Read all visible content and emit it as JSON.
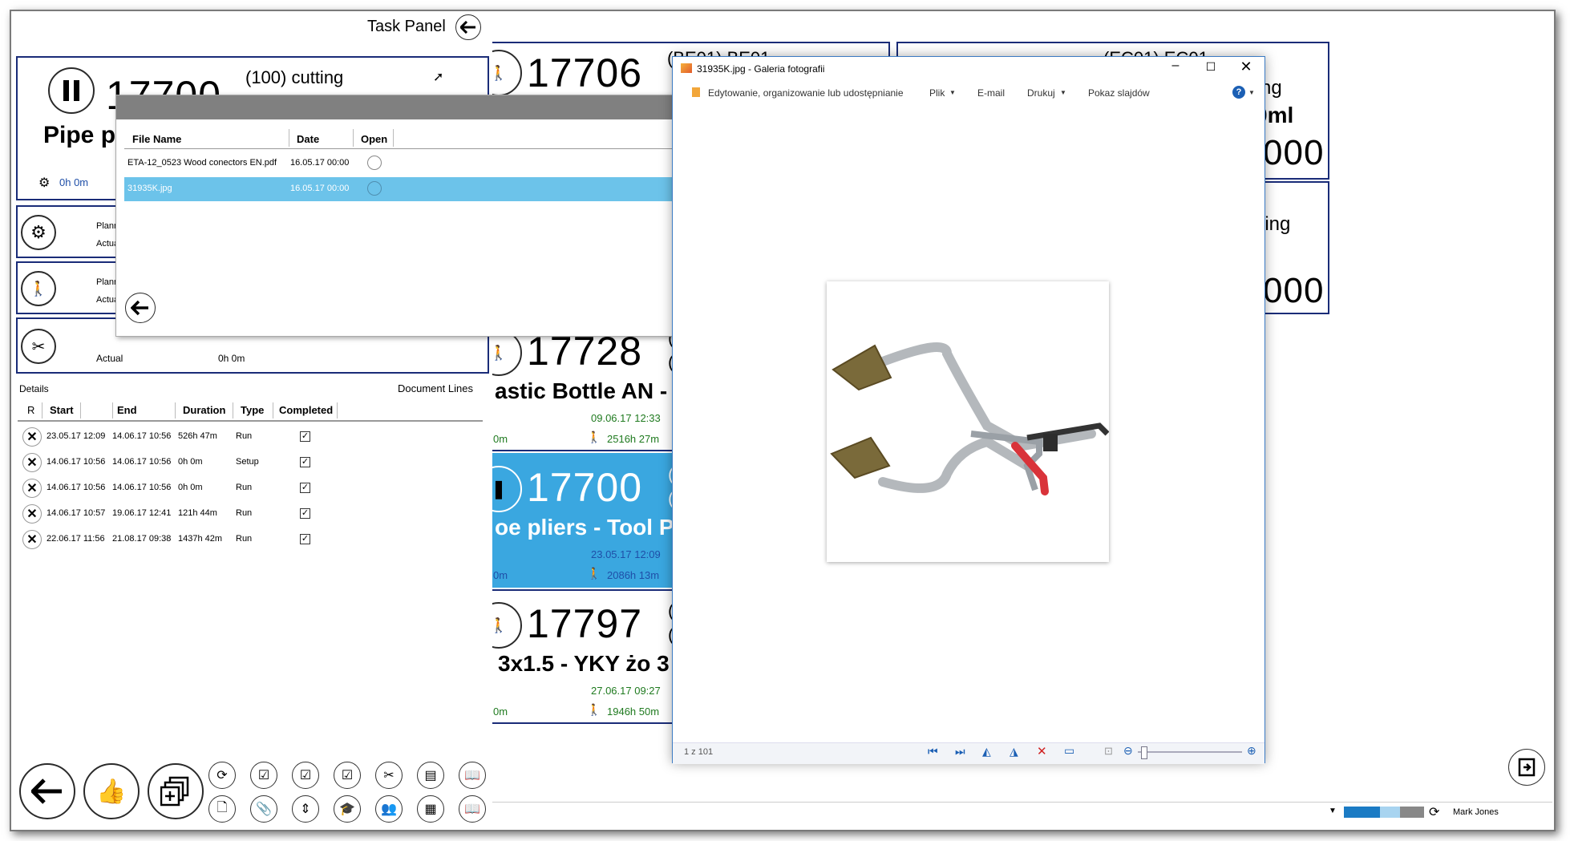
{
  "task_panel": {
    "title": "Task Panel",
    "current": {
      "number": "17700",
      "operation": "(100) cutting",
      "product": "Pipe p",
      "setup_time": "0h 0m"
    },
    "rows": [
      {
        "label1": "Plann",
        "label2": "Actua"
      },
      {
        "label1": "Plann",
        "label2": "Actua"
      },
      {
        "label2": "Actual",
        "value": "0h 0m"
      }
    ],
    "details_label": "Details",
    "document_lines_label": "Document Lines",
    "columns": [
      "R",
      "Start",
      "End",
      "Duration",
      "Type",
      "Completed"
    ],
    "details": [
      {
        "start": "23.05.17 12:09",
        "end": "14.06.17 10:56",
        "duration": "526h 47m",
        "type": "Run",
        "completed": true
      },
      {
        "start": "14.06.17 10:56",
        "end": "14.06.17 10:56",
        "duration": "0h 0m",
        "type": "Setup",
        "completed": true
      },
      {
        "start": "14.06.17 10:56",
        "end": "14.06.17 10:56",
        "duration": "0h 0m",
        "type": "Run",
        "completed": true
      },
      {
        "start": "14.06.17 10:57",
        "end": "19.06.17 12:41",
        "duration": "121h 44m",
        "type": "Run",
        "completed": true
      },
      {
        "start": "22.06.17 11:56",
        "end": "21.08.17 09:38",
        "duration": "1437h 42m",
        "type": "Run",
        "completed": true
      }
    ]
  },
  "files_dialog": {
    "columns": [
      "File Name",
      "Date",
      "Open"
    ],
    "files": [
      {
        "name": "ETA-12_0523 Wood conectors EN.pdf",
        "date": "16.05.17 00:00",
        "selected": false
      },
      {
        "name": "31935K.jpg",
        "date": "16.05.17 00:00",
        "selected": true
      }
    ]
  },
  "job_cards": [
    {
      "number": "17706",
      "code": "(BE01) BE01"
    },
    {
      "number": "17728",
      "paren": "(",
      "paren2": "(",
      "product": "astic Bottle AN -",
      "date": "09.06.17 12:33",
      "time_left": "0m",
      "time_right": "2516h 27m"
    },
    {
      "number": "17700",
      "paren": "(",
      "paren2": "(",
      "product": "oe pliers - Tool P",
      "date": "23.05.17 12:09",
      "time_left": "0m",
      "time_right": "2086h 13m",
      "active": true
    },
    {
      "number": "17797",
      "paren": "(",
      "paren2": "(",
      "product": "3x1.5 - YKY żo 3",
      "date": "27.06.17 09:27",
      "time_left": "0m",
      "time_right": "1946h 50m"
    }
  ],
  "right_cards": [
    {
      "code": "(EC01) EC01",
      "frag1": "ng",
      "frag2": "0ml",
      "frag3": "000"
    },
    {
      "frag1": "ling",
      "frag3": "000"
    }
  ],
  "viewer": {
    "title": "31935K.jpg - Galeria fotografii",
    "menu": [
      "Edytowanie, organizowanie lub udostępnianie",
      "Plik",
      "E-mail",
      "Drukuj",
      "Pokaz slajdów"
    ],
    "counter": "1 z 101"
  },
  "status": {
    "user": "Mark Jones"
  },
  "colors": {
    "card_border": "#1a2c78",
    "active_card": "#3aa7e0",
    "selected_row": "#6cc3ea"
  }
}
